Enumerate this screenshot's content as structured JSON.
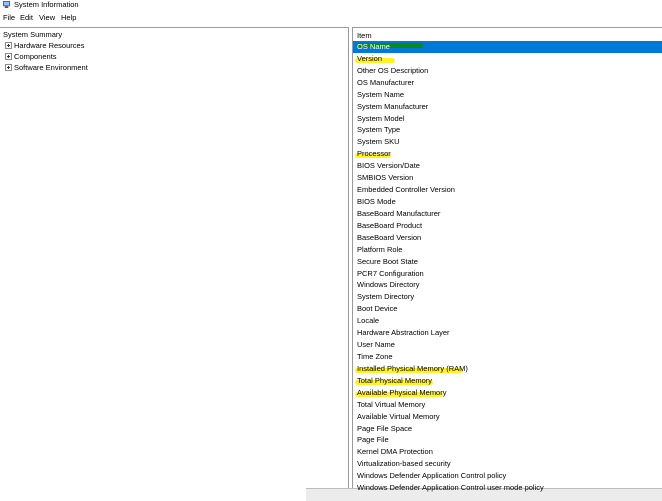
{
  "window": {
    "title": "System Information",
    "icon": "system-info-icon"
  },
  "menu": [
    "File",
    "Edit",
    "View",
    "Help"
  ],
  "tree": {
    "root": "System Summary",
    "nodes": [
      "Hardware Resources",
      "Components",
      "Software Environment"
    ]
  },
  "list": {
    "header": "Item",
    "items": [
      "OS Name",
      "Version",
      "Other OS Description",
      "OS Manufacturer",
      "System Name",
      "System Manufacturer",
      "System Model",
      "System Type",
      "System SKU",
      "Processor",
      "BIOS Version/Date",
      "SMBIOS Version",
      "Embedded Controller Version",
      "BIOS Mode",
      "BaseBoard Manufacturer",
      "BaseBoard Product",
      "BaseBoard Version",
      "Platform Role",
      "Secure Boot State",
      "PCR7 Configuration",
      "Windows Directory",
      "System Directory",
      "Boot Device",
      "Locale",
      "Hardware Abstraction Layer",
      "User Name",
      "Time Zone",
      "Installed Physical Memory (RAM)",
      "Total Physical Memory",
      "Available Physical Memory",
      "Total Virtual Memory",
      "Available Virtual Memory",
      "Page File Space",
      "Page File",
      "Kernel DMA Protection",
      "Virtualization-based security",
      "Windows Defender Application Control policy",
      "Windows Defender Application Control user mode policy"
    ],
    "selected_item": "OS Name",
    "highlighted_items": [
      "Version",
      "Processor",
      "Installed Physical Memory (RAM)",
      "Total Physical Memory",
      "Available Physical Memory"
    ]
  },
  "colors": {
    "selection": "#0078d7",
    "yellow_highlight": "#fff000",
    "green_highlight": "#0b8a1c"
  }
}
